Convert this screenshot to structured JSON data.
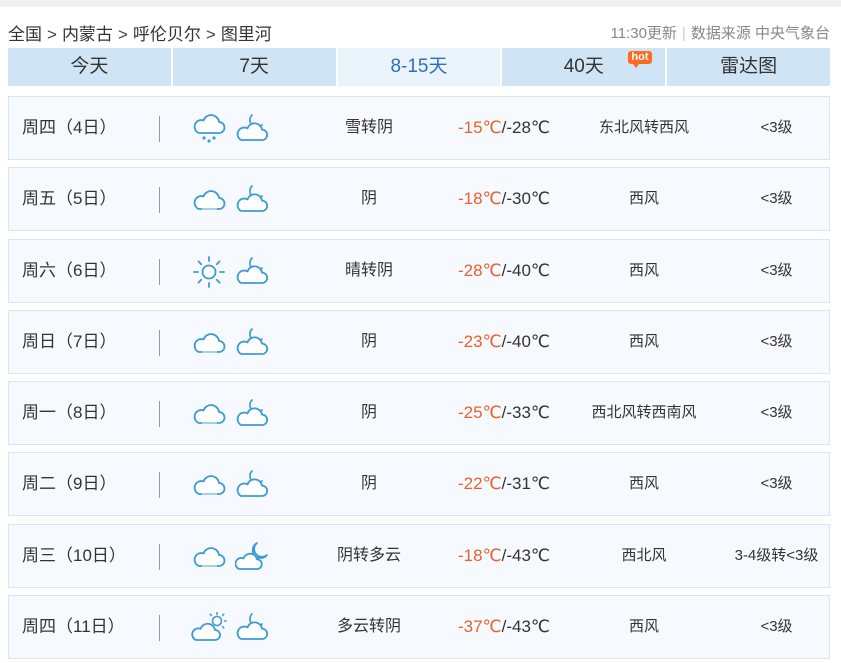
{
  "breadcrumb": [
    "全国",
    "内蒙古",
    "呼伦贝尔",
    "图里河"
  ],
  "update_time": "11:30更新",
  "source": "数据来源 中央气象台",
  "tabs": [
    {
      "label": "今天"
    },
    {
      "label": "7天"
    },
    {
      "label": "8-15天",
      "active": true
    },
    {
      "label": "40天",
      "badge": "hot"
    },
    {
      "label": "雷达图"
    }
  ],
  "colors": {
    "high_temp": "#e8612c",
    "active_tab": "#2f6fba",
    "icon_stroke": "#3d9bd6"
  },
  "forecast": [
    {
      "day": "周四（4日）",
      "icons": [
        "snow-cloud-icon",
        "cloudy-night-icon"
      ],
      "desc": "雪转阴",
      "high": "-15℃",
      "low": "/-28℃",
      "wind": "东北风转西风",
      "level": "<3级"
    },
    {
      "day": "周五（5日）",
      "icons": [
        "overcast-icon",
        "cloudy-night-icon"
      ],
      "desc": "阴",
      "high": "-18℃",
      "low": "/-30℃",
      "wind": "西风",
      "level": "<3级"
    },
    {
      "day": "周六（6日）",
      "icons": [
        "sun-icon",
        "cloudy-night-icon"
      ],
      "desc": "晴转阴",
      "high": "-28℃",
      "low": "/-40℃",
      "wind": "西风",
      "level": "<3级"
    },
    {
      "day": "周日（7日）",
      "icons": [
        "overcast-icon",
        "cloudy-night-icon"
      ],
      "desc": "阴",
      "high": "-23℃",
      "low": "/-40℃",
      "wind": "西风",
      "level": "<3级"
    },
    {
      "day": "周一（8日）",
      "icons": [
        "overcast-icon",
        "cloudy-night-icon"
      ],
      "desc": "阴",
      "high": "-25℃",
      "low": "/-33℃",
      "wind": "西北风转西南风",
      "level": "<3级"
    },
    {
      "day": "周二（9日）",
      "icons": [
        "overcast-icon",
        "cloudy-night-icon"
      ],
      "desc": "阴",
      "high": "-22℃",
      "low": "/-31℃",
      "wind": "西风",
      "level": "<3级"
    },
    {
      "day": "周三（10日）",
      "icons": [
        "overcast-icon",
        "partly-cloudy-night-icon"
      ],
      "desc": "阴转多云",
      "high": "-18℃",
      "low": "/-43℃",
      "wind": "西北风",
      "level": "3-4级转<3级"
    },
    {
      "day": "周四（11日）",
      "icons": [
        "partly-cloudy-day-icon",
        "cloudy-night-icon"
      ],
      "desc": "多云转阴",
      "high": "-37℃",
      "low": "/-43℃",
      "wind": "西风",
      "level": "<3级"
    }
  ]
}
